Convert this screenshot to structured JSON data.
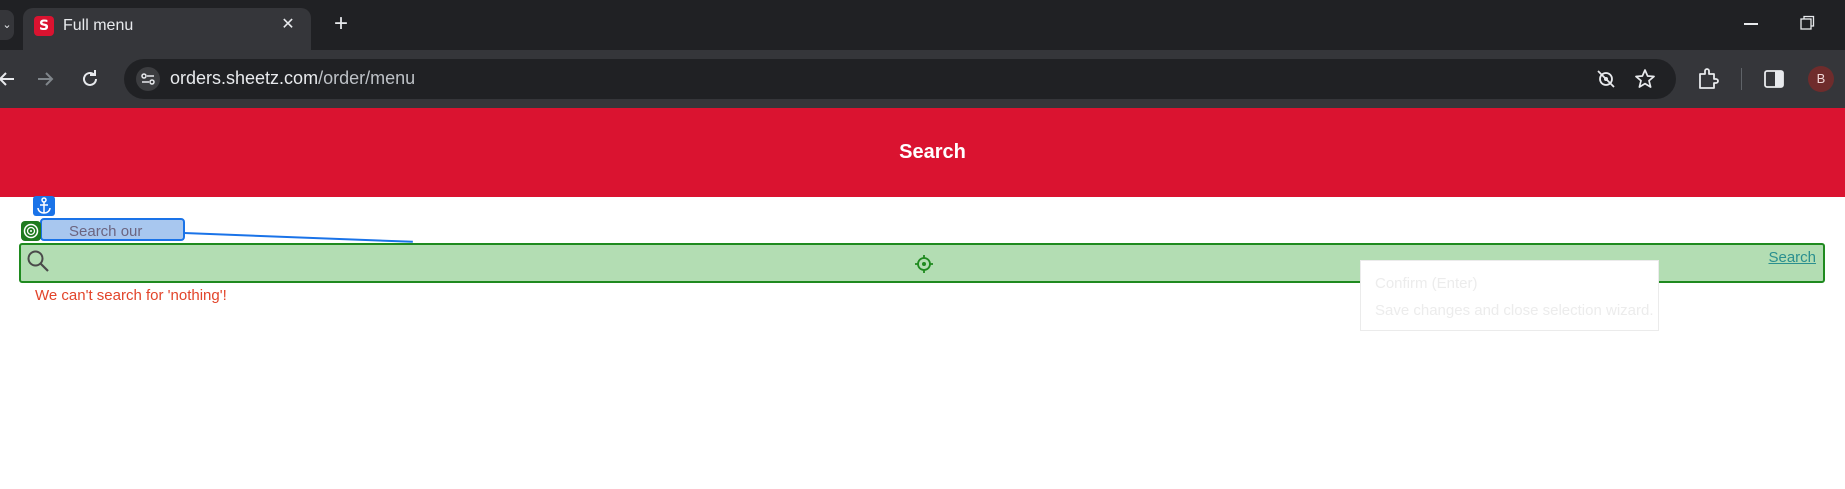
{
  "browser": {
    "tab": {
      "title": "Full menu",
      "favicon_letter": "S"
    },
    "tab_edge_glyph": "⌄",
    "new_tab_glyph": "+",
    "close_glyph": "✕",
    "url": {
      "host": "orders.sheetz.com",
      "path": "/order/menu"
    },
    "avatar_letter": "B"
  },
  "page": {
    "header_title": "Search",
    "search": {
      "label": "Search our menu",
      "button_label": "Search",
      "value": ""
    },
    "error_message": "We can't search for 'nothing'!"
  },
  "overlay_tooltip": {
    "title": "Confirm (Enter)",
    "description": "Save changes and close selection wizard."
  },
  "colors": {
    "brand_red": "#da1330",
    "highlight_green": "#b3ddb3",
    "highlight_blue": "#a8c7ef",
    "error": "#e2442a",
    "link": "#2a8f8f"
  },
  "icons": [
    "back-icon",
    "forward-icon",
    "reload-icon",
    "site-info-icon",
    "tracking-protection-icon",
    "bookmark-star-icon",
    "extensions-icon",
    "side-panel-icon",
    "anchor-icon",
    "target-icon",
    "search-icon",
    "crosshair-icon"
  ]
}
